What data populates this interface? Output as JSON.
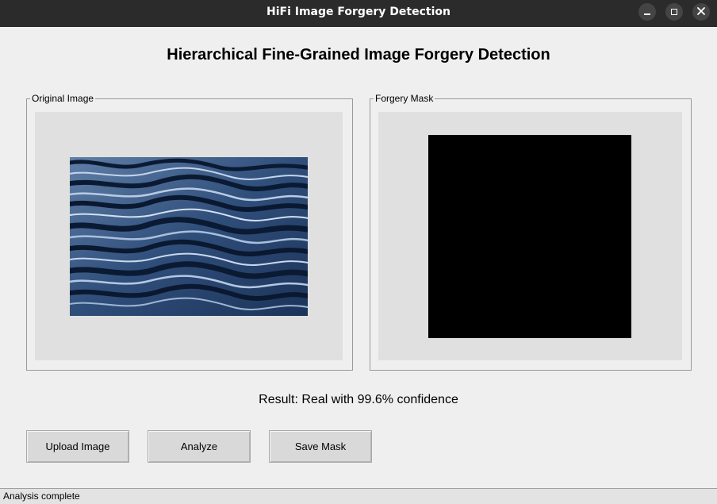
{
  "window": {
    "title": "HiFi Image Forgery Detection",
    "controls": [
      "minimize-icon",
      "maximize-icon",
      "close-icon"
    ]
  },
  "heading": "Hierarchical Fine-Grained Image Forgery Detection",
  "panels": {
    "original": {
      "label": "Original Image"
    },
    "mask": {
      "label": "Forgery Mask"
    }
  },
  "result": "Result: Real with 99.6% confidence",
  "buttons": {
    "upload": "Upload Image",
    "analyze": "Analyze",
    "save": "Save Mask"
  },
  "status": "Analysis complete",
  "colors": {
    "titlebar": "#2b2b2b",
    "background": "#efefef",
    "canvas": "#e0e0e0",
    "mask": "#000000",
    "water": "#2a4670"
  }
}
